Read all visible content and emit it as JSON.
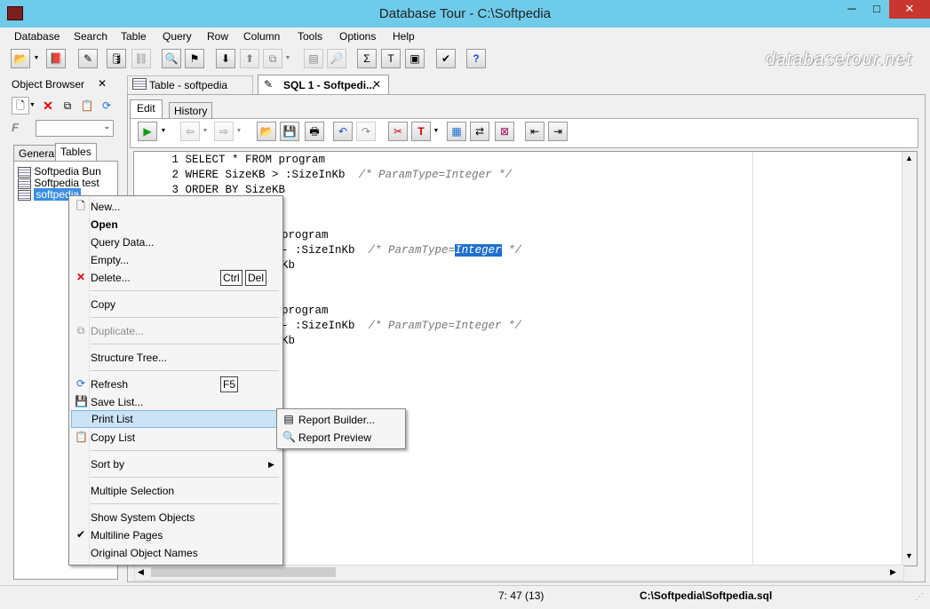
{
  "window": {
    "title": "Database Tour - C:\\Softpedia",
    "minimize": "─",
    "maximize": "□",
    "close": "✕"
  },
  "menu": [
    "Database",
    "Search",
    "Table",
    "Query",
    "Row",
    "Column",
    "Tools",
    "Options",
    "Help"
  ],
  "watermark": "databasetour.net",
  "object_browser": {
    "title": "Object Browser",
    "close": "✕",
    "filter_label": "F",
    "tabs": [
      "General",
      "Tables"
    ]
  },
  "tables": [
    "Softpedia Bun",
    "Softpedia test",
    "softpedia"
  ],
  "doc_tabs": [
    {
      "label": "Table - softpedia"
    },
    {
      "label": "SQL 1 - Softpedi...",
      "close": "✕"
    }
  ],
  "editor_tabs": [
    "Edit",
    "History"
  ],
  "sql": {
    "block1": [
      {
        "n": "1",
        "code": "SELECT * FROM program"
      },
      {
        "n": "2",
        "code": "WHERE SizeKB > :SizeInKb  ",
        "comment": "/* ParamType=Integer */"
      },
      {
        "n": "3",
        "code": "ORDER BY SizeKB"
      }
    ],
    "block2": {
      "l1": "program",
      "l2_code": "- :SizeInKb  ",
      "l2_comment_pre": "/* ParamType=",
      "l2_selected": "Integer",
      "l2_comment_post": " */",
      "l3": "Kb"
    },
    "block3": {
      "l1": "program",
      "l2_code": "- :SizeInKb  ",
      "l2_comment": "/* ParamType=Integer */",
      "l3": "Kb"
    }
  },
  "context_menu": {
    "new": "New...",
    "open": "Open",
    "query_data": "Query Data...",
    "empty": "Empty...",
    "delete": "Delete...",
    "delete_key1": "Ctrl",
    "delete_key2": "Del",
    "copy": "Copy",
    "duplicate": "Duplicate...",
    "structure_tree": "Structure Tree...",
    "refresh": "Refresh",
    "refresh_key": "F5",
    "save_list": "Save List...",
    "print_list": "Print List",
    "copy_list": "Copy List",
    "sort_by": "Sort by",
    "multiple_selection": "Multiple Selection",
    "show_system_objects": "Show System Objects",
    "multiline_pages": "Multiline Pages",
    "original_object_names": "Original Object Names"
  },
  "submenu": {
    "report_builder": "Report Builder...",
    "report_preview": "Report Preview"
  },
  "status": {
    "position": "7:  47  (13)",
    "file": "C:\\Softpedia\\Softpedia.sql"
  }
}
